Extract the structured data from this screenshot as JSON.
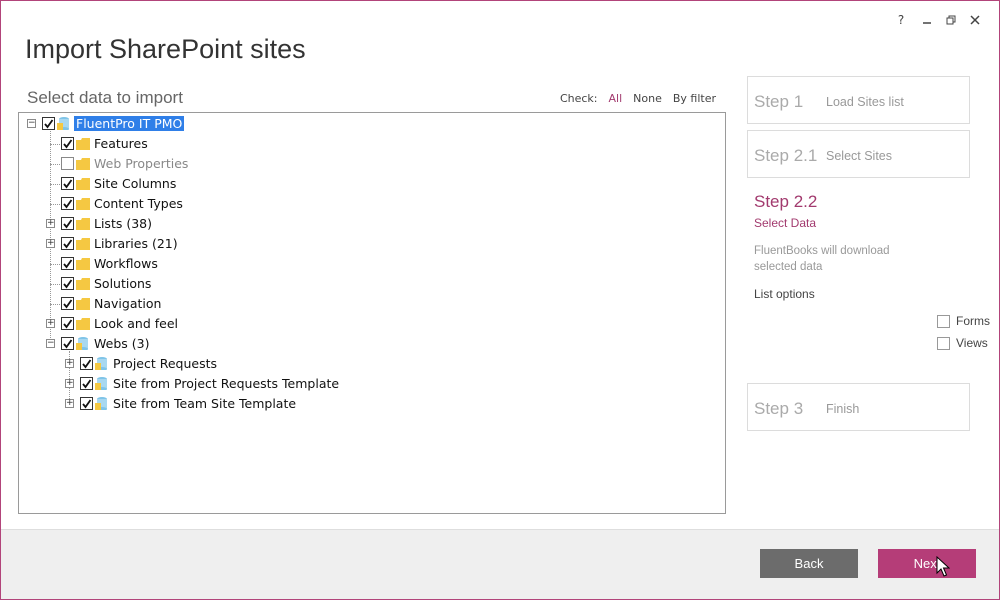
{
  "window": {
    "help": "?",
    "title": "Import SharePoint sites"
  },
  "main": {
    "subtitle": "Select data to import",
    "check": {
      "label": "Check:",
      "all": "All",
      "none": "None",
      "by_filter": "By filter"
    }
  },
  "tree": {
    "root": {
      "label": "FluentPro IT PMO",
      "checked": true
    },
    "items": [
      {
        "label": "Features",
        "checked": true
      },
      {
        "label": "Web Properties",
        "checked": false
      },
      {
        "label": "Site Columns",
        "checked": true
      },
      {
        "label": "Content Types",
        "checked": true
      },
      {
        "label": "Lists (38)",
        "checked": true
      },
      {
        "label": "Libraries (21)",
        "checked": true
      },
      {
        "label": "Workflows",
        "checked": true
      },
      {
        "label": "Solutions",
        "checked": true
      },
      {
        "label": "Navigation",
        "checked": true
      },
      {
        "label": "Look and feel",
        "checked": true
      },
      {
        "label": "Webs (3)",
        "checked": true
      }
    ],
    "webs": [
      {
        "label": "Project Requests",
        "checked": true
      },
      {
        "label": "Site from Project Requests Template",
        "checked": true
      },
      {
        "label": "Site from Team Site Template",
        "checked": true
      }
    ]
  },
  "steps": {
    "step1": {
      "title": "Step 1",
      "sub": "Load Sites list"
    },
    "step21": {
      "title": "Step 2.1",
      "sub": "Select Sites"
    },
    "step22": {
      "title": "Step 2.2",
      "sub": "Select Data",
      "desc": "FluentBooks will download selected data",
      "list_options": "List options",
      "forms": "Forms",
      "views": "Views"
    },
    "step3": {
      "title": "Step 3",
      "sub": "Finish"
    }
  },
  "footer": {
    "back": "Back",
    "next": "Next"
  },
  "colors": {
    "accent": "#b53d78",
    "selection": "#2f7fe8",
    "folder": "#f5c842"
  }
}
